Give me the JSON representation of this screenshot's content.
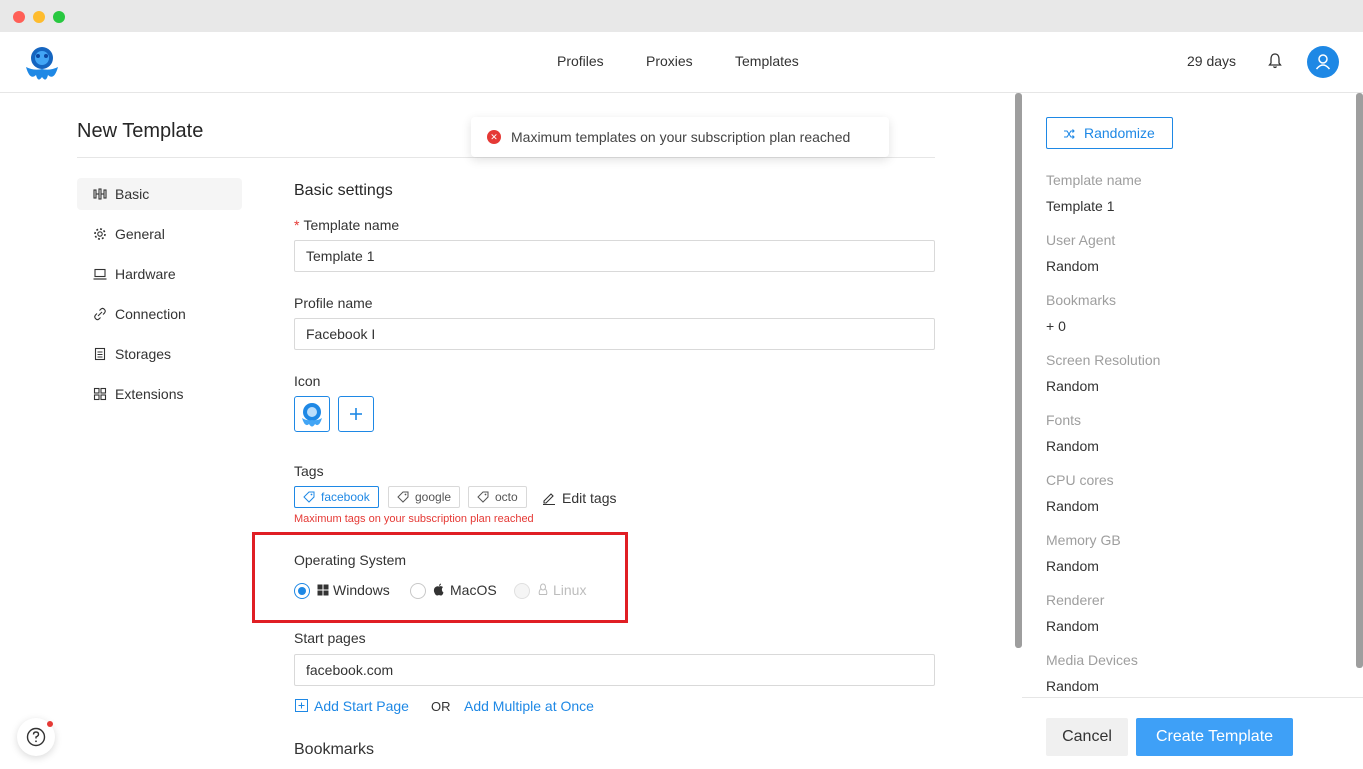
{
  "nav": {
    "items": [
      {
        "label": "Profiles"
      },
      {
        "label": "Proxies"
      },
      {
        "label": "Templates"
      }
    ],
    "days_left": "29 days",
    "icons": {
      "bell": "bell-icon",
      "avatar": "user-icon",
      "logo": "octopus-logo"
    }
  },
  "toast": {
    "message": "Maximum templates on your subscription plan reached",
    "icon": "error-icon",
    "color": "#e53935"
  },
  "page": {
    "title": "New Template"
  },
  "sidebar": {
    "items": [
      {
        "label": "Basic",
        "icon": "sliders-icon",
        "active": true
      },
      {
        "label": "General",
        "icon": "gear-icon",
        "active": false
      },
      {
        "label": "Hardware",
        "icon": "laptop-icon",
        "active": false
      },
      {
        "label": "Connection",
        "icon": "link-icon",
        "active": false
      },
      {
        "label": "Storages",
        "icon": "database-icon",
        "active": false
      },
      {
        "label": "Extensions",
        "icon": "grid-icon",
        "active": false
      }
    ]
  },
  "form": {
    "section_title": "Basic settings",
    "template_name": {
      "label": "Template name",
      "required_mark": "*",
      "value": "Template 1"
    },
    "profile_name": {
      "label": "Profile name",
      "value": "Facebook I"
    },
    "icon": {
      "label": "Icon"
    },
    "tags": {
      "label": "Tags",
      "items": [
        {
          "label": "facebook",
          "selected": true
        },
        {
          "label": "google",
          "selected": false
        },
        {
          "label": "octo",
          "selected": false
        }
      ],
      "edit_label": "Edit tags",
      "error": "Maximum tags on your subscription plan reached"
    },
    "os": {
      "label": "Operating System",
      "options": [
        {
          "label": "Windows",
          "icon": "windows-icon",
          "checked": true,
          "disabled": false
        },
        {
          "label": "MacOS",
          "icon": "apple-icon",
          "checked": false,
          "disabled": false
        },
        {
          "label": "Linux",
          "icon": "linux-icon",
          "checked": false,
          "disabled": true
        }
      ]
    },
    "start_pages": {
      "label": "Start pages",
      "value": "facebook.com",
      "add_label": "Add Start Page",
      "or_label": "OR",
      "add_multiple_label": "Add Multiple at Once"
    },
    "bookmarks_title": "Bookmarks"
  },
  "summary": {
    "randomize_label": "Randomize",
    "items": [
      {
        "label": "Template name",
        "value": "Template 1"
      },
      {
        "label": "User Agent",
        "value": "Random"
      },
      {
        "label": "Bookmarks",
        "value": "+ 0"
      },
      {
        "label": "Screen Resolution",
        "value": "Random"
      },
      {
        "label": "Fonts",
        "value": "Random"
      },
      {
        "label": "CPU cores",
        "value": "Random"
      },
      {
        "label": "Memory GB",
        "value": "Random"
      },
      {
        "label": "Renderer",
        "value": "Random"
      },
      {
        "label": "Media Devices",
        "value": "Random"
      }
    ]
  },
  "footer": {
    "cancel_label": "Cancel",
    "create_label": "Create Template"
  },
  "colors": {
    "accent": "#1e88e5",
    "error": "#e53935",
    "highlight_box": "#e01e24"
  }
}
